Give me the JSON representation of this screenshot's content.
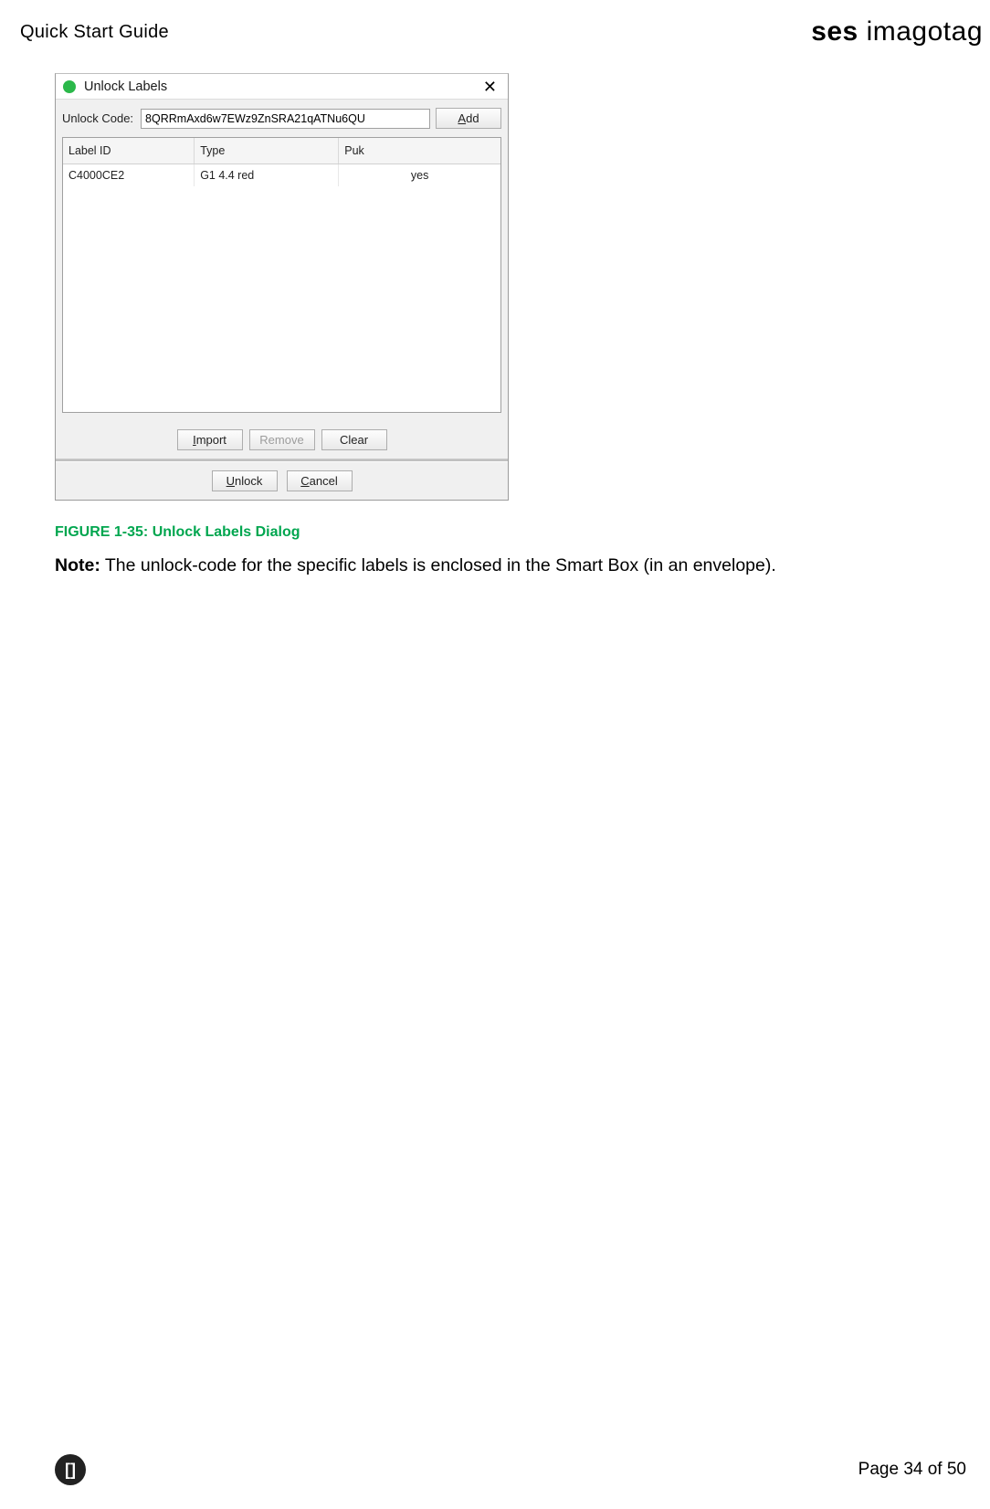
{
  "header": {
    "doc_title": "Quick Start Guide",
    "brand_bold": "ses",
    "brand_light": " imagotag"
  },
  "dialog": {
    "title": "Unlock Labels",
    "close_glyph": "✕",
    "unlock_code_label": "Unlock Code:",
    "unlock_code_value": "8QRRmAxd6w7EWz9ZnSRA21qATNu6QU",
    "add_btn_prefix": "A",
    "add_btn_rest": "dd",
    "table": {
      "col_label_id": "Label ID",
      "col_type": "Type",
      "col_puk": "Puk",
      "rows": [
        {
          "label_id": "C4000CE2",
          "type": "G1 4.4 red",
          "puk": "yes"
        }
      ]
    },
    "import_btn_prefix": "I",
    "import_btn_rest": "mport",
    "remove_btn": "Remove",
    "clear_btn": "Clear",
    "unlock_btn_prefix": "U",
    "unlock_btn_rest": "nlock",
    "cancel_btn_prefix": "C",
    "cancel_btn_rest": "ancel"
  },
  "caption": "FIGURE 1-35: Unlock Labels Dialog",
  "note_label": "Note:",
  "note_text": " The unlock-code for the specific labels is enclosed in the Smart Box (in an envelope).",
  "footer": {
    "badge": "[]",
    "page": "Page 34 of 50"
  }
}
